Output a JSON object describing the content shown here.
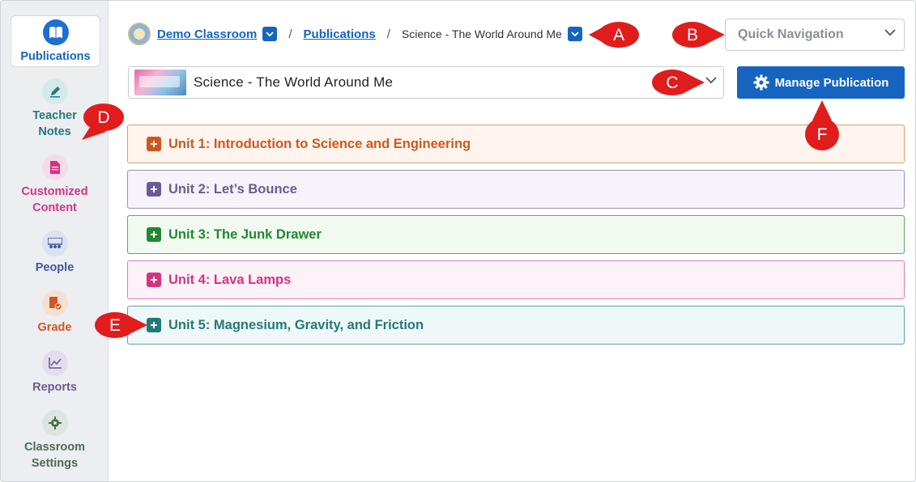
{
  "sidebar": {
    "items": [
      {
        "label": "Publications",
        "icon": "book-icon",
        "color": "#1565c0"
      },
      {
        "label": "Teacher Notes",
        "icon": "pen-icon",
        "color": "#23797a"
      },
      {
        "label": "Customized Content",
        "icon": "document-icon",
        "color": "#d6337e"
      },
      {
        "label": "People",
        "icon": "people-icon",
        "color": "#3f57a6"
      },
      {
        "label": "Grade",
        "icon": "grade-icon",
        "color": "#d1561d"
      },
      {
        "label": "Reports",
        "icon": "chart-icon",
        "color": "#6b5b92"
      },
      {
        "label": "Classroom Settings",
        "icon": "gear-icon",
        "color": "#4d6b52"
      }
    ]
  },
  "breadcrumb": {
    "classroom": "Demo Classroom",
    "publications": "Publications",
    "separator": "/",
    "current": "Science - The World Around Me"
  },
  "quick_nav": {
    "placeholder": "Quick Navigation"
  },
  "publication_select": {
    "value": "Science - The World Around Me"
  },
  "manage_button": {
    "label": "Manage Publication"
  },
  "units": [
    {
      "title": "Unit 1: Introduction to Science and Engineering",
      "color": "#d1561d",
      "bg": "#fff5ee",
      "border": "#e39a6a"
    },
    {
      "title": "Unit 2: Let’s Bounce",
      "color": "#6b5b92",
      "bg": "#f6f3fb",
      "border": "#9d8fbd"
    },
    {
      "title": "Unit 3: The Junk Drawer",
      "color": "#1e8a2e",
      "bg": "#f1faf1",
      "border": "#55ad5f"
    },
    {
      "title": "Unit 4: Lava Lamps",
      "color": "#d6337e",
      "bg": "#fdf2f8",
      "border": "#e17bb0"
    },
    {
      "title": "Unit 5: Magnesium, Gravity, and Friction",
      "color": "#23797a",
      "bg": "#eff8f8",
      "border": "#5ea3a4"
    }
  ],
  "callouts": {
    "a": "A",
    "b": "B",
    "c": "C",
    "d": "D",
    "e": "E",
    "f": "F",
    "color": "#e01c1c"
  }
}
